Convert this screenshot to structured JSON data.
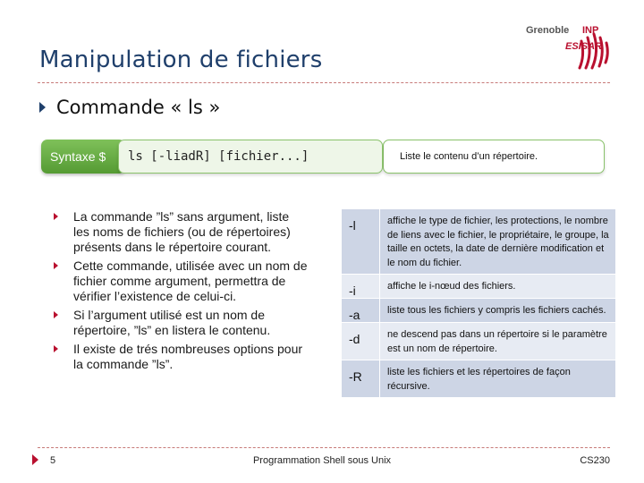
{
  "title": "Manipulation de fichiers",
  "logo": {
    "line1": "Grenoble",
    "line2": "INP",
    "line3": "ESISAR"
  },
  "main_bullet": "Commande « ls »",
  "syntax": {
    "label": "Syntaxe $",
    "code": "ls [-liadR] [fichier...]",
    "description": "Liste le contenu d’un répertoire."
  },
  "bullets": [
    "La commande ”ls” sans argument, liste les noms de fichiers (ou de répertoires) présents dans le répertoire courant.",
    "Cette commande, utilisée avec un nom de  fichier comme argument, permettra de vérifier l’existence de celui-ci.",
    "Si l’argument utilisé est un nom de répertoire, ”ls” en listera le contenu.",
    "Il existe de trés nombreuses options pour la commande ”ls”."
  ],
  "options": [
    {
      "flag": "-l",
      "desc": "affiche le type de fichier, les protections, le nombre de liens avec le fichier, le propriétaire, le groupe, la taille en octets, la date de dernière modification et le nom du fichier."
    },
    {
      "flag": "-i",
      "desc": "affiche le i-nœud des fichiers."
    },
    {
      "flag": "-a",
      "desc": "liste tous les fichiers y compris les fichiers cachés."
    },
    {
      "flag": "-d",
      "desc": "ne descend pas dans un répertoire si le paramètre est un nom de répertoire."
    },
    {
      "flag": "-R",
      "desc": "liste les fichiers et les répertoires de façon récursive."
    }
  ],
  "footer": {
    "page_number": "5",
    "center": "Programmation Shell sous Unix",
    "right": "CS230"
  },
  "colors": {
    "title": "#1f3f6b",
    "accent_red": "#b9102f",
    "green": "#6aae45",
    "table_dark": "#cdd5e5",
    "table_light": "#e7ebf3"
  }
}
